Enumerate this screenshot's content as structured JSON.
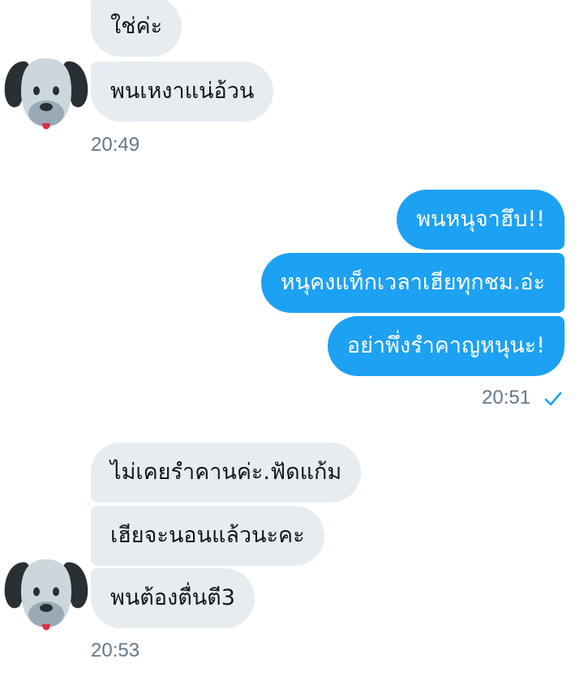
{
  "conversation": {
    "incoming_group_1": {
      "messages": [
        "ใช่ค่ะ",
        "พนเหงาแน่อ้วน"
      ],
      "time": "20:49"
    },
    "outgoing_group": {
      "messages": [
        "พนหนุจาฮึบ!!",
        "หนุคงแท็กเวลาเฮียทุกชม.อ่ะ",
        "อย่าพึ่งรำคาญหนุนะ!"
      ],
      "time": "20:51",
      "status_icon": "read-check-icon"
    },
    "incoming_group_2": {
      "messages": [
        "ไม่เคยรำคานค่ะ.ฟัดแก้ม",
        "เฮียจะนอนแล้วนะคะ",
        "พนต้องตื่นตี3"
      ],
      "time": "20:53"
    },
    "avatar_icon": "dog-face-icon"
  },
  "colors": {
    "incoming_bubble": "#e6ecf0",
    "outgoing_bubble": "#1da1f2",
    "timestamp": "#657786",
    "check": "#1da1f2"
  }
}
